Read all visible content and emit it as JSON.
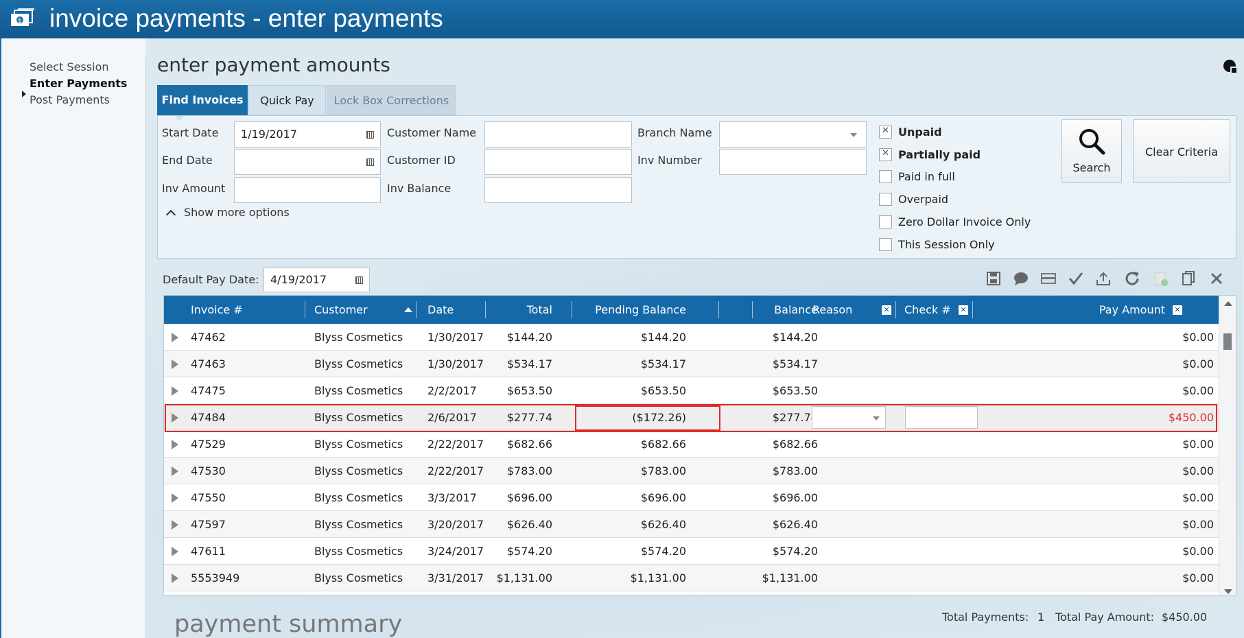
{
  "window": {
    "title": "invoice payments - enter payments"
  },
  "nav": {
    "items": [
      {
        "label": "Select Session"
      },
      {
        "label": "Enter Payments"
      },
      {
        "label": "Post Payments"
      }
    ]
  },
  "page": {
    "title": "enter payment amounts"
  },
  "tabs": [
    {
      "label": "Find Invoices"
    },
    {
      "label": "Quick Pay"
    },
    {
      "label": "Lock Box Corrections"
    }
  ],
  "criteria": {
    "start_date": {
      "label": "Start Date",
      "value": "1/19/2017"
    },
    "end_date": {
      "label": "End Date",
      "value": ""
    },
    "inv_amount": {
      "label": "Inv Amount",
      "value": ""
    },
    "customer_name": {
      "label": "Customer Name",
      "value": ""
    },
    "customer_id": {
      "label": "Customer ID",
      "value": ""
    },
    "inv_balance": {
      "label": "Inv Balance",
      "value": ""
    },
    "branch_name": {
      "label": "Branch Name",
      "value": ""
    },
    "inv_number": {
      "label": "Inv Number",
      "value": ""
    },
    "show_more": "Show more options",
    "statuses": [
      {
        "label": "Unpaid",
        "checked": true
      },
      {
        "label": "Partially paid",
        "checked": true
      },
      {
        "label": "Paid in full",
        "checked": false
      },
      {
        "label": "Overpaid",
        "checked": false
      },
      {
        "label": "Zero Dollar Invoice Only",
        "checked": false
      },
      {
        "label": "This Session Only",
        "checked": false
      }
    ],
    "search_label": "Search",
    "clear_label": "Clear Criteria"
  },
  "default_pay_date": {
    "label": "Default Pay Date:",
    "value": "4/19/2017"
  },
  "toolbar_icons": [
    "save-icon",
    "comment-icon",
    "card-icon",
    "checkmark-icon",
    "upload-icon",
    "refresh-icon",
    "add-doc-icon",
    "copy-icon",
    "close-icon"
  ],
  "grid": {
    "columns": {
      "invoice": "Invoice #",
      "customer": "Customer",
      "date": "Date",
      "total": "Total",
      "pending": "Pending Balance",
      "balance": "Balance",
      "reason": "Reason",
      "check": "Check #",
      "pay": "Pay Amount"
    },
    "rows": [
      {
        "invoice": "47462",
        "customer": "Blyss Cosmetics",
        "date": "1/30/2017",
        "total": "$144.20",
        "pending": "$144.20",
        "balance": "$144.20",
        "pay": "$0.00"
      },
      {
        "invoice": "47463",
        "customer": "Blyss Cosmetics",
        "date": "1/30/2017",
        "total": "$534.17",
        "pending": "$534.17",
        "balance": "$534.17",
        "pay": "$0.00"
      },
      {
        "invoice": "47475",
        "customer": "Blyss Cosmetics",
        "date": "2/2/2017",
        "total": "$653.50",
        "pending": "$653.50",
        "balance": "$653.50",
        "pay": "$0.00"
      },
      {
        "invoice": "47484",
        "customer": "Blyss Cosmetics",
        "date": "2/6/2017",
        "total": "$277.74",
        "pending": "($172.26)",
        "balance": "$277.74",
        "pay": "$450.00"
      },
      {
        "invoice": "47529",
        "customer": "Blyss Cosmetics",
        "date": "2/22/2017",
        "total": "$682.66",
        "pending": "$682.66",
        "balance": "$682.66",
        "pay": "$0.00"
      },
      {
        "invoice": "47530",
        "customer": "Blyss Cosmetics",
        "date": "2/22/2017",
        "total": "$783.00",
        "pending": "$783.00",
        "balance": "$783.00",
        "pay": "$0.00"
      },
      {
        "invoice": "47550",
        "customer": "Blyss Cosmetics",
        "date": "3/3/2017",
        "total": "$696.00",
        "pending": "$696.00",
        "balance": "$696.00",
        "pay": "$0.00"
      },
      {
        "invoice": "47597",
        "customer": "Blyss Cosmetics",
        "date": "3/20/2017",
        "total": "$626.40",
        "pending": "$626.40",
        "balance": "$626.40",
        "pay": "$0.00"
      },
      {
        "invoice": "47611",
        "customer": "Blyss Cosmetics",
        "date": "3/24/2017",
        "total": "$574.20",
        "pending": "$574.20",
        "balance": "$574.20",
        "pay": "$0.00"
      },
      {
        "invoice": "5553949",
        "customer": "Blyss Cosmetics",
        "date": "3/31/2017",
        "total": "$1,131.00",
        "pending": "$1,131.00",
        "balance": "$1,131.00",
        "pay": "$0.00"
      }
    ]
  },
  "summary": {
    "title": "payment summary",
    "total_payments_label": "Total Payments:",
    "total_payments_value": "1",
    "total_pay_amount_label": "Total Pay Amount:",
    "total_pay_amount_value": "$450.00"
  },
  "colors": {
    "brand": "#1669a8",
    "highlight": "#e02a2a",
    "pay_red": "#e02a2a"
  }
}
